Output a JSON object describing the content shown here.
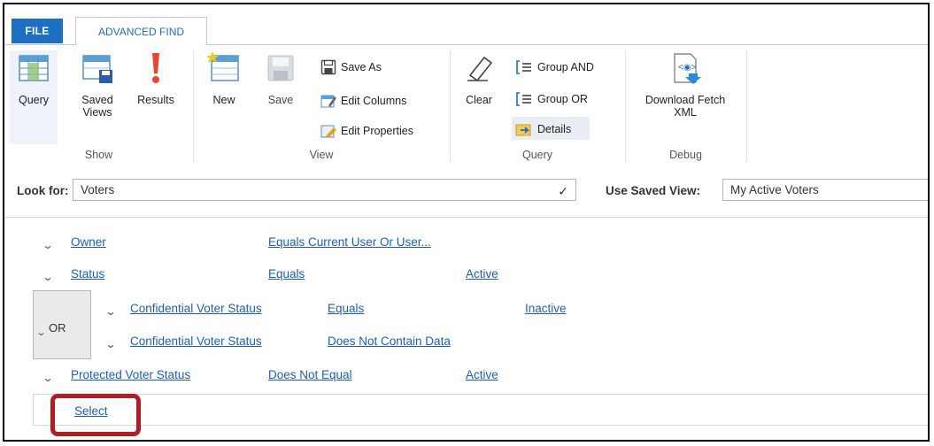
{
  "tabs": {
    "file": "FILE",
    "advanced_find": "ADVANCED FIND"
  },
  "ribbon": {
    "show": {
      "label": "Show",
      "query": "Query",
      "saved_views_1": "Saved",
      "saved_views_2": "Views",
      "results": "Results"
    },
    "view": {
      "label": "View",
      "new": "New",
      "save": "Save",
      "save_as": "Save As",
      "edit_columns": "Edit Columns",
      "edit_properties": "Edit Properties"
    },
    "query": {
      "label": "Query",
      "clear": "Clear",
      "group_and": "Group AND",
      "group_or": "Group OR",
      "details": "Details"
    },
    "debug": {
      "label": "Debug",
      "download_1": "Download Fetch",
      "download_2": "XML"
    }
  },
  "look_for": {
    "label": "Look for:",
    "value": "Voters",
    "saved_view_label": "Use Saved View:",
    "saved_view_value": "My Active Voters"
  },
  "criteria": {
    "row1": {
      "field": "Owner",
      "operator": "Equals Current User Or User..."
    },
    "row2": {
      "field": "Status",
      "operator": "Equals",
      "value": "Active"
    },
    "group": {
      "label": "OR",
      "row1": {
        "field": "Confidential Voter Status",
        "operator": "Equals",
        "value": "Inactive"
      },
      "row2": {
        "field": "Confidential Voter Status",
        "operator": "Does Not Contain Data"
      }
    },
    "row3": {
      "field": "Protected Voter Status",
      "operator": "Does Not Equal",
      "value": "Active"
    },
    "select": "Select"
  },
  "colors": {
    "accent": "#1c6fc2",
    "link": "#1c5fb8",
    "highlight": "#b01e24"
  }
}
